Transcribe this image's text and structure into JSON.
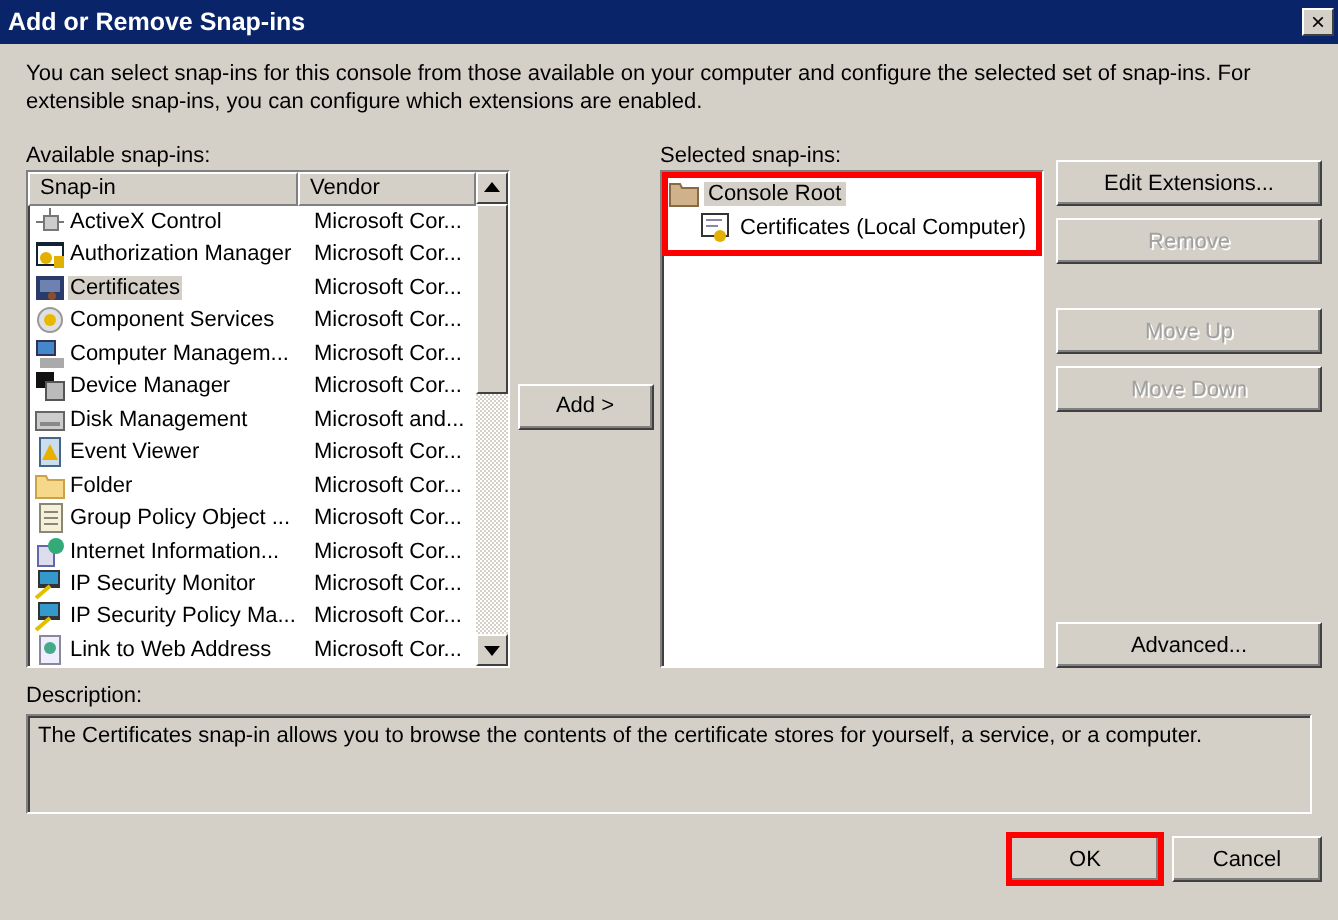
{
  "window": {
    "title": "Add or Remove Snap-ins",
    "close": "×"
  },
  "intro": "You can select snap-ins for this console from those available on your computer and configure the selected set of snap-ins. For extensible snap-ins, you can configure which extensions are enabled.",
  "available": {
    "label": "Available snap-ins:",
    "columns": [
      "Snap-in",
      "Vendor"
    ],
    "rows": [
      {
        "name": "ActiveX Control",
        "vendor": "Microsoft Cor...",
        "selected": false
      },
      {
        "name": "Authorization Manager",
        "vendor": "Microsoft Cor...",
        "selected": false
      },
      {
        "name": "Certificates",
        "vendor": "Microsoft Cor...",
        "selected": true
      },
      {
        "name": "Component Services",
        "vendor": "Microsoft Cor...",
        "selected": false
      },
      {
        "name": "Computer Managem...",
        "vendor": "Microsoft Cor...",
        "selected": false
      },
      {
        "name": "Device Manager",
        "vendor": "Microsoft Cor...",
        "selected": false
      },
      {
        "name": "Disk Management",
        "vendor": "Microsoft and...",
        "selected": false
      },
      {
        "name": "Event Viewer",
        "vendor": "Microsoft Cor...",
        "selected": false
      },
      {
        "name": "Folder",
        "vendor": "Microsoft Cor...",
        "selected": false
      },
      {
        "name": "Group Policy Object ...",
        "vendor": "Microsoft Cor...",
        "selected": false
      },
      {
        "name": "Internet Information...",
        "vendor": "Microsoft Cor...",
        "selected": false
      },
      {
        "name": "IP Security Monitor",
        "vendor": "Microsoft Cor...",
        "selected": false
      },
      {
        "name": "IP Security Policy Ma...",
        "vendor": "Microsoft Cor...",
        "selected": false
      },
      {
        "name": "Link to Web Address",
        "vendor": "Microsoft Cor...",
        "selected": false
      }
    ]
  },
  "add_button": {
    "label": "Add >",
    "disabled": false
  },
  "selected_snapins": {
    "label": "Selected snap-ins:",
    "highlighted": true,
    "tree": [
      {
        "label": "Console Root",
        "selected": true,
        "children": [
          {
            "label": "Certificates (Local Computer)",
            "selected": false
          }
        ]
      }
    ]
  },
  "side_buttons": [
    {
      "label": "Edit Extensions...",
      "disabled": false
    },
    {
      "label": "Remove",
      "disabled": true
    },
    {
      "label": "Move Up",
      "disabled": true
    },
    {
      "label": "Move Down",
      "disabled": true
    },
    {
      "label": "Advanced...",
      "disabled": false
    }
  ],
  "description": {
    "label": "Description:",
    "text": "The Certificates snap-in allows you to browse the contents of the certificate stores for yourself, a service, or a computer."
  },
  "buttons": [
    {
      "label": "OK",
      "highlighted": true
    },
    {
      "label": "Cancel",
      "highlighted": false
    }
  ]
}
